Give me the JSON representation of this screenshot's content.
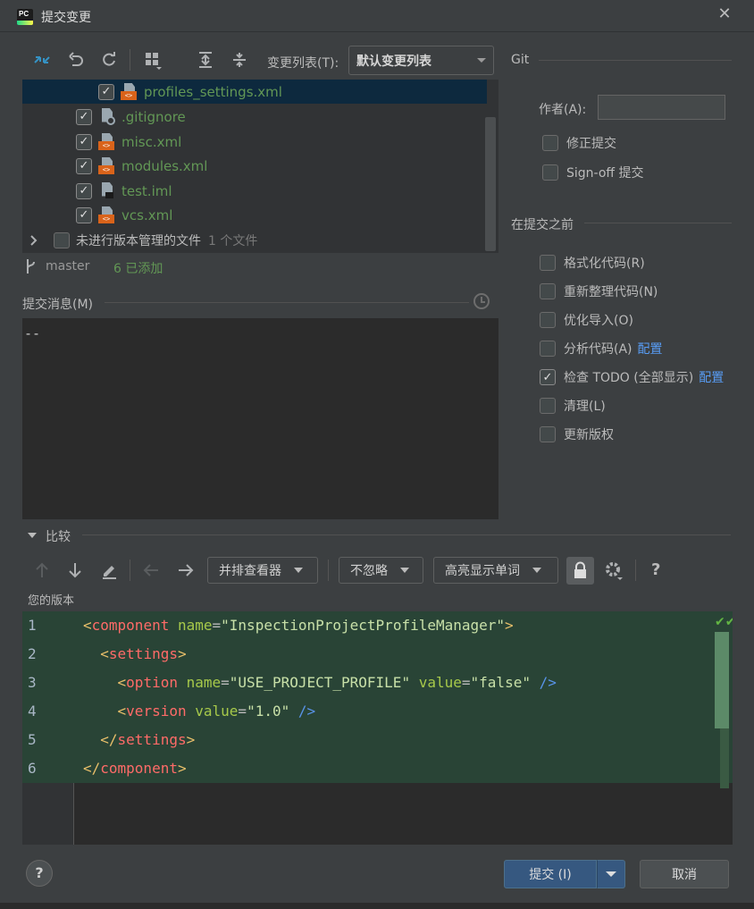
{
  "window": {
    "title": "提交变更",
    "close": "✕"
  },
  "toolbar": {
    "changelist_label": "变更列表(T):",
    "changelist_value": "默认变更列表"
  },
  "tree": {
    "items": [
      {
        "name": "profiles_settings.xml",
        "checked": true,
        "type": "xml"
      },
      {
        "name": ".gitignore",
        "checked": true,
        "type": "ignore"
      },
      {
        "name": "misc.xml",
        "checked": true,
        "type": "xml"
      },
      {
        "name": "modules.xml",
        "checked": true,
        "type": "xml"
      },
      {
        "name": "test.iml",
        "checked": true,
        "type": "iml"
      },
      {
        "name": "vcs.xml",
        "checked": true,
        "type": "xml"
      }
    ],
    "unversioned_label": "未进行版本管理的文件",
    "unversioned_count": "1 个文件"
  },
  "status": {
    "branch": "master",
    "added": "6 已添加"
  },
  "message": {
    "label": "提交消息(M)",
    "text": "--"
  },
  "git": {
    "title": "Git",
    "author_label": "作者(A):",
    "author_value": "",
    "amend": "修正提交",
    "signoff": "Sign-off 提交"
  },
  "before_commit": {
    "title": "在提交之前",
    "options": [
      {
        "label": "格式化代码(R)",
        "checked": false
      },
      {
        "label": "重新整理代码(N)",
        "checked": false
      },
      {
        "label": "优化导入(O)",
        "checked": false
      },
      {
        "label": "分析代码(A)",
        "checked": false,
        "link": "配置"
      },
      {
        "label": "检查 TODO (全部显示)",
        "checked": true,
        "link": "配置"
      },
      {
        "label": "清理(L)",
        "checked": false
      },
      {
        "label": "更新版权",
        "checked": false
      }
    ]
  },
  "diff": {
    "title": "比较",
    "viewer": "并排查看器",
    "ignore": "不忽略",
    "highlight": "高亮显示单词",
    "help": "?",
    "your_version": "您的版本",
    "lines": [
      "1",
      "2",
      "3",
      "4",
      "5",
      "6"
    ]
  },
  "footer": {
    "help": "?",
    "commit": "提交 (I)",
    "cancel": "取消"
  },
  "colors": {
    "accent": "#365880",
    "added_text": "#629755",
    "link": "#589df6",
    "diff_added_bg": "#294436"
  }
}
